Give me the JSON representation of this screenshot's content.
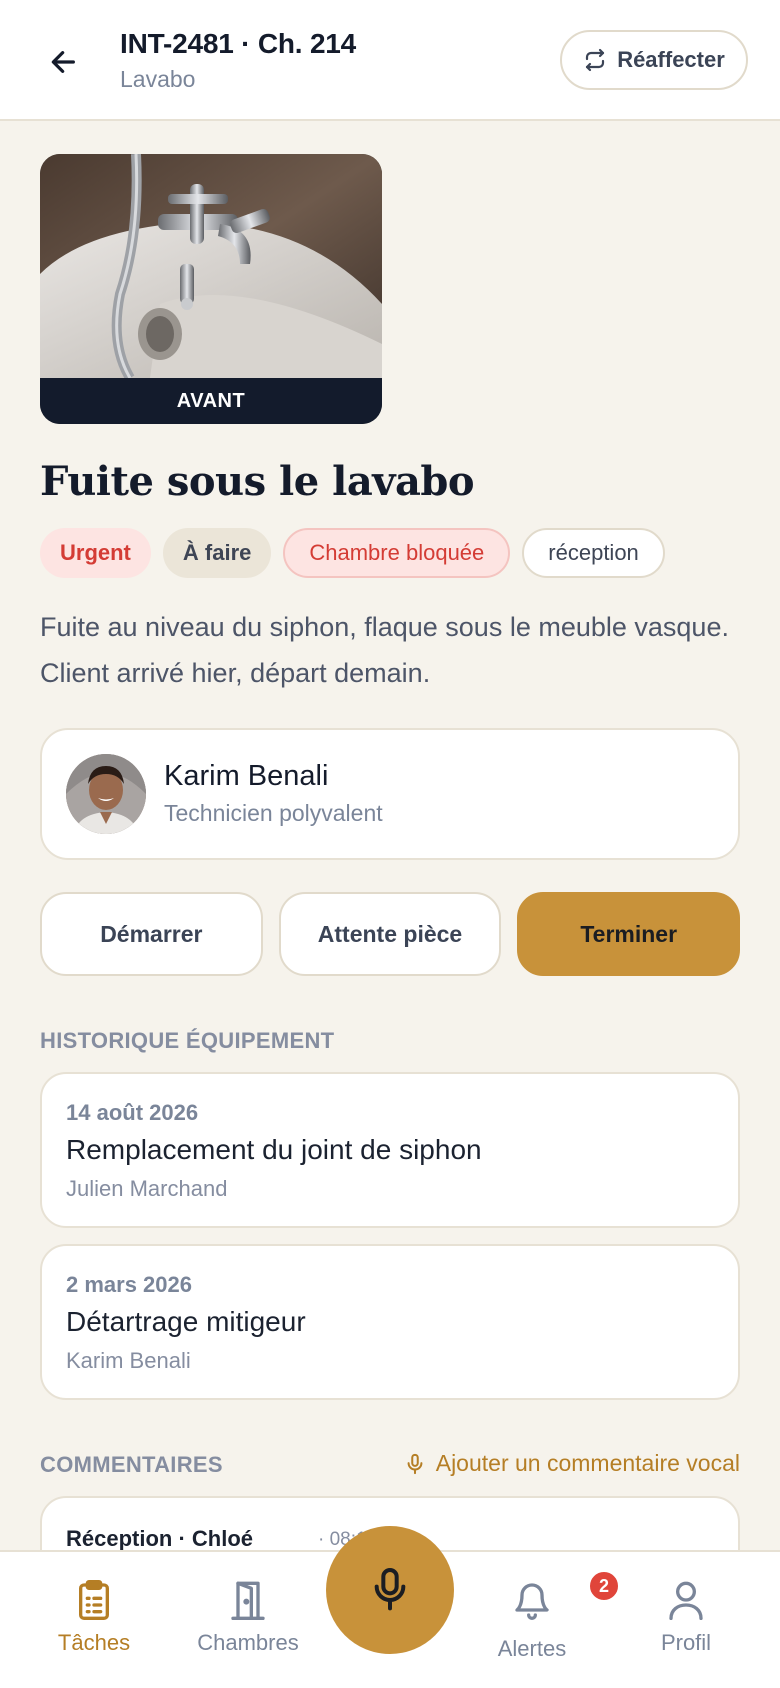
{
  "header": {
    "title": "INT-2481 · Ch. 214",
    "subtitle": "Lavabo",
    "reassign_label": "Réaffecter"
  },
  "photo": {
    "label": "AVANT"
  },
  "task": {
    "title": "Fuite sous le lavabo",
    "tags": [
      "Urgent",
      "À faire",
      "Chambre bloquée",
      "réception"
    ],
    "description": "Fuite au niveau du siphon, flaque sous le meuble vasque. Client arrivé hier, départ demain."
  },
  "assignee": {
    "name": "Karim Benali",
    "role": "Technicien polyvalent"
  },
  "actions": {
    "start": "Démarrer",
    "wait": "Attente pièce",
    "finish": "Terminer"
  },
  "history": {
    "label": "HISTORIQUE ÉQUIPEMENT",
    "items": [
      {
        "date": "14 août 2026",
        "title": "Remplacement du joint de siphon",
        "author": "Julien Marchand"
      },
      {
        "date": "2 mars 2026",
        "title": "Détartrage mitigeur",
        "author": "Karim Benali"
      }
    ]
  },
  "comments": {
    "label": "COMMENTAIRES",
    "add_voice": "Ajouter un commentaire vocal",
    "items": [
      {
        "author": "Réception · Chloé",
        "time": "· 08:12"
      }
    ]
  },
  "nav": {
    "tasks": "Tâches",
    "rooms": "Chambres",
    "alerts": "Alertes",
    "alerts_badge": "2",
    "profile": "Profil"
  },
  "colors": {
    "accent": "#c8923a",
    "urgent": "#d43c35",
    "background": "#f6f3ec"
  }
}
